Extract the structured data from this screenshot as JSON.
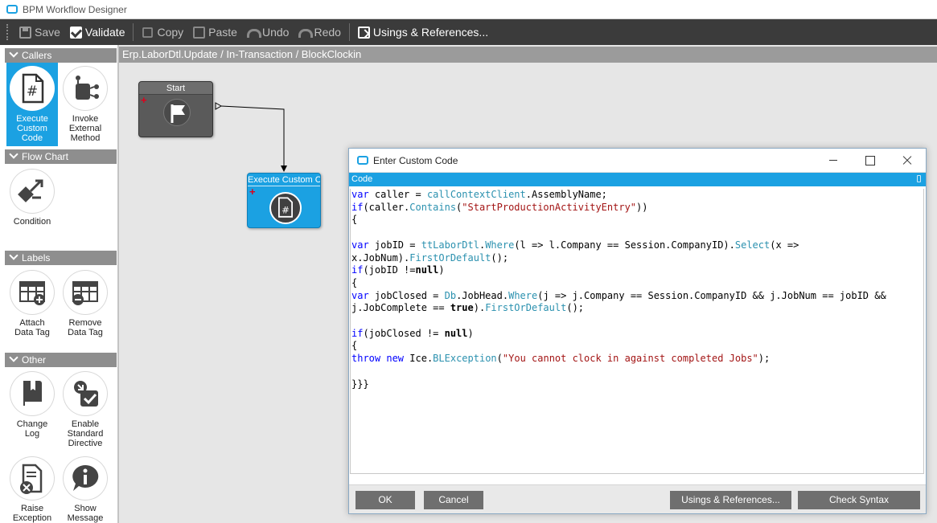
{
  "window": {
    "title": "BPM Workflow Designer"
  },
  "toolbar": {
    "save": "Save",
    "validate": "Validate",
    "copy": "Copy",
    "paste": "Paste",
    "undo": "Undo",
    "redo": "Redo",
    "usings": "Usings & References..."
  },
  "palette": {
    "callers": {
      "header": "Callers",
      "execute": [
        "Execute",
        "Custom",
        "Code"
      ],
      "invoke": [
        "Invoke",
        "External",
        "Method"
      ]
    },
    "flowchart": {
      "header": "Flow Chart",
      "condition": "Condition"
    },
    "labels": {
      "header": "Labels",
      "attach": [
        "Attach",
        "Data Tag"
      ],
      "remove": [
        "Remove",
        "Data Tag"
      ]
    },
    "other": {
      "header": "Other",
      "changelog": [
        "Change",
        "Log"
      ],
      "enable": [
        "Enable",
        "Standard",
        "Directive"
      ],
      "raise": [
        "Raise",
        "Exception"
      ],
      "show": [
        "Show",
        "Message"
      ]
    }
  },
  "canvas": {
    "breadcrumb": "Erp.LaborDtl.Update / In-Transaction / BlockClockin",
    "start_node": "Start",
    "exec_node": "Execute Custom Code"
  },
  "dialog": {
    "title": "Enter Custom Code",
    "code_header": "Code",
    "buttons": {
      "ok": "OK",
      "cancel": "Cancel",
      "usings": "Usings & References...",
      "check": "Check Syntax"
    }
  },
  "colors": {
    "accent": "#1ba1e2",
    "toolbar": "#3b3b3b",
    "node_dark": "#5a5a5a",
    "palette_header": "#8e8e8e"
  }
}
